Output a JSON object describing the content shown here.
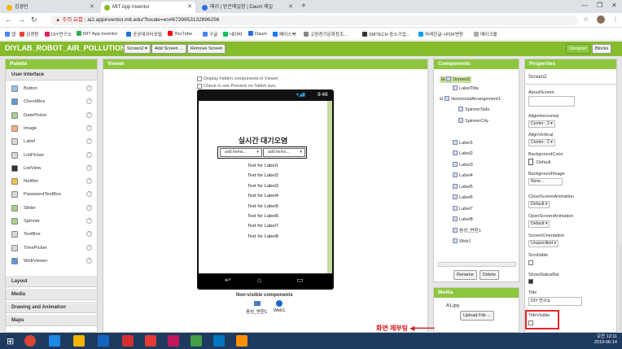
{
  "browser": {
    "tabs": [
      {
        "label": "김경란",
        "fav_color": "#f4b400"
      },
      {
        "label": "MIT App Inventor",
        "fav_color": "#86bb2c"
      },
      {
        "label": "메리 | 받은메일함 | Daum 메일",
        "fav_color": "#2f6fdd"
      }
    ],
    "warning": "주의 요함",
    "url": "ai2.appinventor.mit.edu/?locale=en#6739953132896256",
    "bookmarks": [
      {
        "label": "앱",
        "color": "#4285f4"
      },
      {
        "label": "김경환",
        "color": "#e94235"
      },
      {
        "label": "DIY연구소",
        "color": "#e91e63"
      },
      {
        "label": "MIT App Inventor",
        "color": "#34a853"
      },
      {
        "label": "공공데이터포털",
        "color": "#1a73e8"
      },
      {
        "label": "YouTube",
        "color": "#ff0000"
      },
      {
        "label": "구글",
        "color": "#4285f4"
      },
      {
        "label": "네이버",
        "color": "#03c75a"
      },
      {
        "label": "Daum",
        "color": "#2f6fdd"
      },
      {
        "label": "페이스북",
        "color": "#1877f2"
      },
      {
        "label": "고양경기문화창조...",
        "color": "#888888"
      },
      {
        "label": "SMTECH 중소기업...",
        "color": "#333333"
      },
      {
        "label": "마레한글->PDF변환",
        "color": "#00a0e9"
      },
      {
        "label": "메이크올",
        "color": "#aaaaaa"
      }
    ]
  },
  "app": {
    "project_name": "DIYLAB_ROBOT_AIR_POLLUTION1",
    "screen_select": "Screen2 ▾",
    "add_screen": "Add Screen ...",
    "remove_screen": "Remove Screen",
    "designer": "Designer",
    "blocks": "Blocks"
  },
  "palette": {
    "title": "Palette",
    "section_ui": "User Interface",
    "items": [
      "Button",
      "CheckBox",
      "DatePicker",
      "Image",
      "Label",
      "ListPicker",
      "ListView",
      "Notifier",
      "PasswordTextBox",
      "Slider",
      "Spinner",
      "TextBox",
      "TimePicker",
      "WebViewer"
    ],
    "help": "?",
    "sections": [
      "Layout",
      "Media",
      "Drawing and Animation",
      "Maps"
    ]
  },
  "viewer": {
    "title": "Viewer",
    "hidden_check": "Display hidden components in Viewer",
    "tablet_check": "Check to see Preview on Tablet size.",
    "status_time": "9:48",
    "heading": "실시간 대기오염",
    "spinner1": "add items...",
    "spinner2": "add items...",
    "labels": [
      "Text for Label1",
      "Text for Label2",
      "Text for Label3",
      "Text for Label4",
      "Text for Label5",
      "Text for Label6",
      "Text for Label7",
      "Text for Label8"
    ],
    "nonvisible_title": "Non-visible components",
    "nonvisible": [
      "음성_변환1",
      "Web1"
    ]
  },
  "components": {
    "title": "Components",
    "tree": [
      "Screen2",
      "LabelTitle",
      "HorizontalArrangement1",
      "SpinnerSido",
      "SpinnerCity",
      "Label1",
      "Label1",
      "Label2",
      "Label3",
      "Label4",
      "Label5",
      "Label6",
      "Label7",
      "Label8",
      "음성_변환1",
      "Web1"
    ],
    "rename": "Rename",
    "delete": "Delete"
  },
  "media": {
    "title": "Media",
    "file": "A1.jpg",
    "upload": "Upload File ..."
  },
  "properties": {
    "title": "Properties",
    "component": "Screen2",
    "about": "AboutScreen",
    "align_h": "AlignHorizontal",
    "align_h_val": "Center : 3 ▾",
    "align_v": "AlignVertical",
    "align_v_val": "Center : 2 ▾",
    "bg_color": "BackgroundColor",
    "bg_color_val": "Default",
    "bg_image": "BackgroundImage",
    "bg_image_val": "None...",
    "close_anim": "CloseScreenAnimation",
    "close_anim_val": "Default ▾",
    "open_anim": "OpenScreenAnimation",
    "open_anim_val": "Default ▾",
    "orientation": "ScreenOrientation",
    "orientation_val": "Unspecified ▾",
    "scrollable": "Scrollable",
    "show_status": "ShowStatusBar",
    "title_label": "Title",
    "title_val": "DIY 연구소",
    "title_visible": "TitleVisible"
  },
  "annotation": "화면 제부팅",
  "clock": {
    "time": "오전 12:11",
    "date": "2019-06-14"
  }
}
